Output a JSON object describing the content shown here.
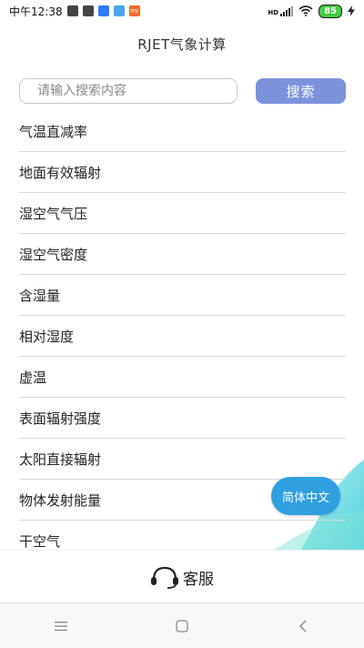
{
  "status_bar": {
    "time": "中午12:38",
    "battery": "85",
    "mi_badge": "mi",
    "hd_label": "HD"
  },
  "header": {
    "title": "RJET气象计算"
  },
  "search": {
    "placeholder": "请输入搜索内容",
    "button_label": "搜索"
  },
  "list": {
    "items": [
      "气温直减率",
      "地面有效辐射",
      "湿空气气压",
      "湿空气密度",
      "含湿量",
      "相对湿度",
      "虚温",
      "表面辐射强度",
      "太阳直接辐射",
      "物体发射能量",
      "干空气"
    ]
  },
  "language_button": "简体中文",
  "service": {
    "label": "客服",
    "icon": "headset-icon"
  },
  "colors": {
    "search_button": "#7c93dc",
    "language_button": "#2f9fe0",
    "battery": "#3ecf3e",
    "wave_accent": "#46d6d0"
  }
}
